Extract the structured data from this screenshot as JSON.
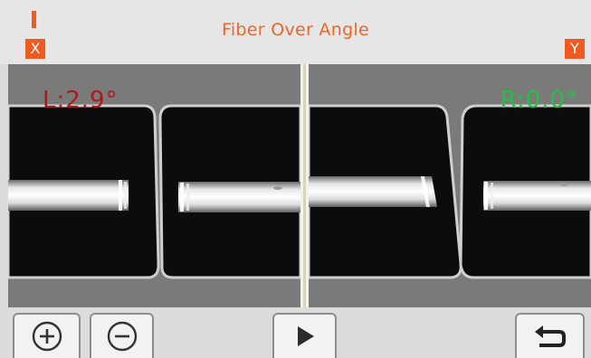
{
  "header": {
    "title": "Fiber Over Angle",
    "left_axis_label": "X",
    "right_axis_label": "Y"
  },
  "views": {
    "left_angle": "L:2.9°",
    "right_angle": "R:0.0°"
  },
  "toolbar": {
    "buttons": [
      {
        "id": "zoom-in",
        "icon": "plus-circle-icon"
      },
      {
        "id": "zoom-out",
        "icon": "minus-circle-icon"
      },
      {
        "id": "play",
        "icon": "play-icon"
      },
      {
        "id": "back",
        "icon": "return-arrow-icon"
      }
    ]
  },
  "colors": {
    "accent": "#f05a22",
    "left_angle": "#b01818",
    "right_angle": "#22c043"
  }
}
